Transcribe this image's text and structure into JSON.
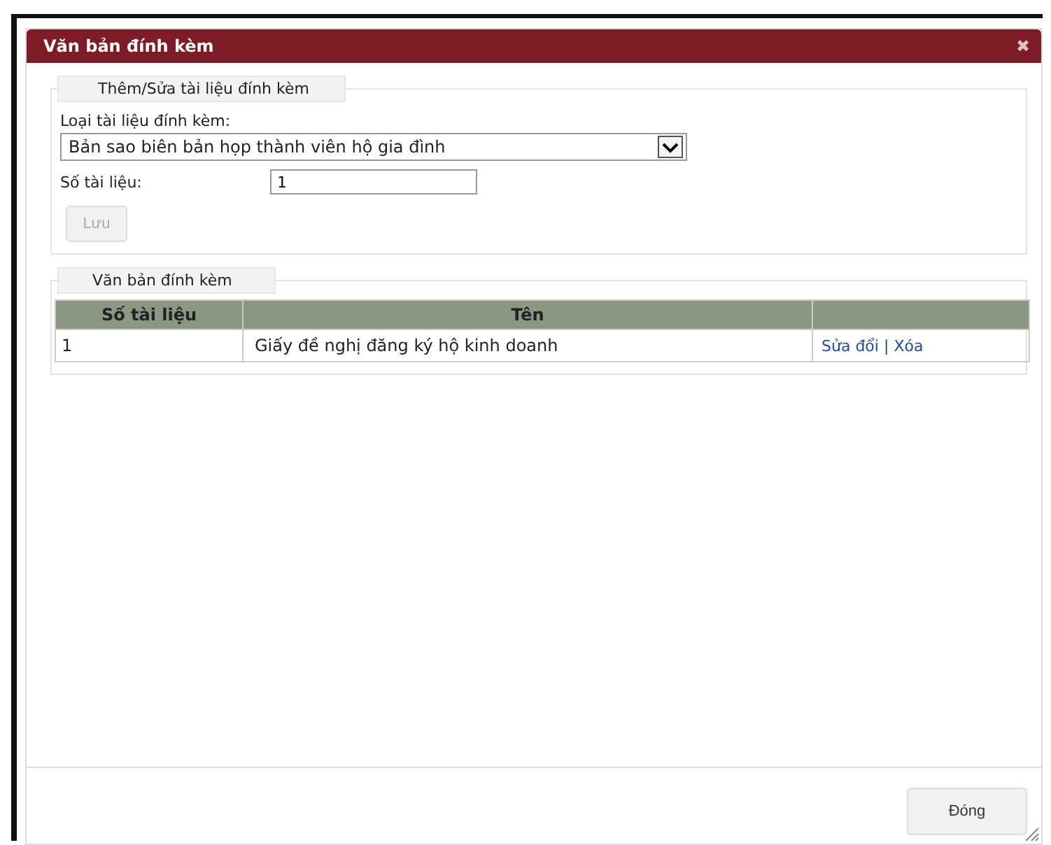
{
  "window": {
    "title": "Văn bản đính kèm",
    "close": "✖"
  },
  "form": {
    "legend": "Thêm/Sửa tài liệu đính kèm",
    "type_label": "Loại tài liệu đính kèm:",
    "type_value": "Bản sao biên bản họp thành viên hộ gia đình",
    "number_label": "Số tài liệu:",
    "number_value": "1",
    "save_button": {
      "label": "Lưu",
      "disabled": true
    }
  },
  "attachments": {
    "legend": "Văn bản đính kèm",
    "columns": [
      "Số tài liệu",
      "Tên"
    ],
    "rows": [
      {
        "number": "1",
        "name": "Giấy đề nghị đăng ký hộ kinh doanh",
        "edit": "Sửa đổi",
        "separator": "|",
        "delete": "Xóa"
      }
    ]
  },
  "close_button": "Đóng"
}
